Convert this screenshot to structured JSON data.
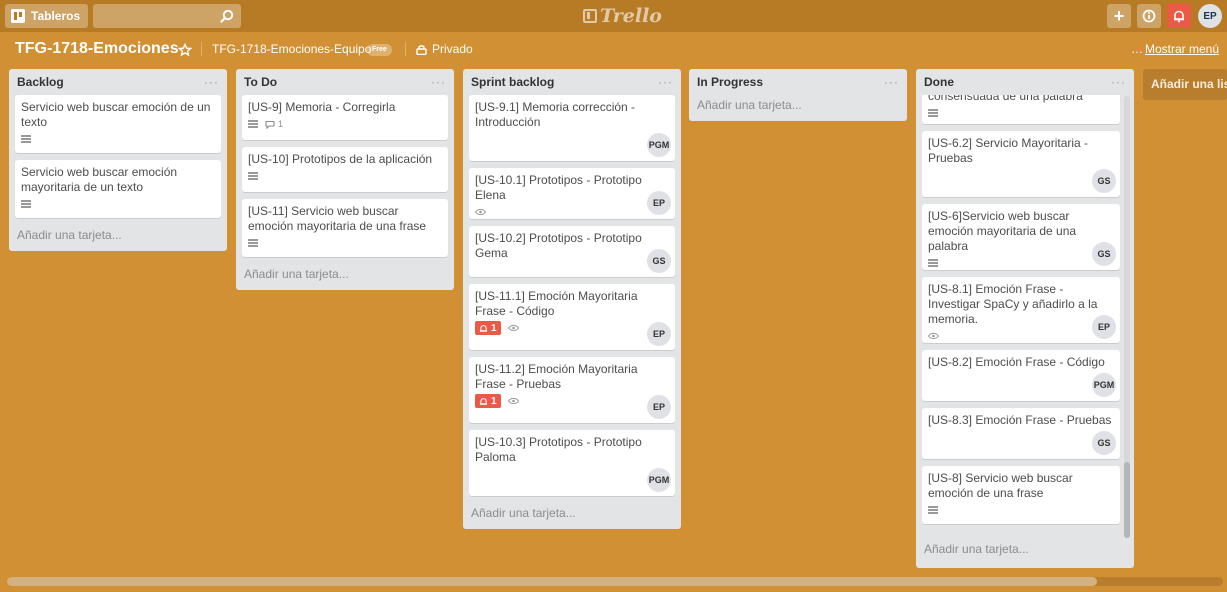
{
  "topbar": {
    "boards_label": "Tableros",
    "search_value": "",
    "logo_text": "Trello",
    "user_initials": "EP"
  },
  "board": {
    "title": "TFG-1718-Emociones",
    "team": "TFG-1718-Emociones-Equipo",
    "team_badge": "Free",
    "privacy": "Privado",
    "show_menu": "Mostrar menú",
    "add_list": "Añadir una lista"
  },
  "colors": {
    "board_bg": "#d29034",
    "topbar_bg": "#b87b25",
    "alarm_red": "#eb5a46",
    "list_bg": "#e2e4e6"
  },
  "lists": [
    {
      "title": "Backlog",
      "menu": "···",
      "add_card": "Añadir una tarjeta...",
      "cards": [
        {
          "text": "Servicio web buscar emoción de un texto"
        },
        {
          "text": "Servicio web buscar emoción mayoritaria de un texto"
        }
      ]
    },
    {
      "title": "To Do",
      "menu": "···",
      "add_card": "Añadir una tarjeta...",
      "cards": [
        {
          "text": "[US-9] Memoria - Corregirla",
          "comments": "1"
        },
        {
          "text": "[US-10] Prototipos de la aplicación"
        },
        {
          "text": "[US-11] Servicio web buscar emoción mayoritaria de una frase"
        }
      ]
    },
    {
      "title": "Sprint backlog",
      "menu": "···",
      "add_card": "Añadir una tarjeta...",
      "cards": [
        {
          "text": "[US-9.1] Memoria corrección - Introducción",
          "member": "PGM"
        },
        {
          "text": "[US-10.1] Prototipos - Prototipo Elena",
          "member": "EP"
        },
        {
          "text": "[US-10.2] Prototipos - Prototipo Gema",
          "member": "GS"
        },
        {
          "text": "[US-11.1] Emoción Mayoritaria Frase - Código",
          "alarm": "1",
          "member": "EP"
        },
        {
          "text": "[US-11.2] Emoción Mayoritaria Frase - Pruebas",
          "alarm": "1",
          "member": "EP"
        },
        {
          "text": "[US-10.3] Prototipos - Prototipo Paloma",
          "member": "PGM"
        }
      ]
    },
    {
      "title": "In Progress",
      "menu": "···",
      "add_card": "Añadir una tarjeta...",
      "cards": []
    },
    {
      "title": "Done",
      "menu": "···",
      "add_card": "Añadir una tarjeta...",
      "cards": [
        {
          "text": "consensuada de una palabra"
        },
        {
          "text": "[US-6.2] Servicio Mayoritaria - Pruebas",
          "member": "GS"
        },
        {
          "text": "[US-6]Servicio web buscar emoción mayoritaria de una palabra",
          "member": "GS"
        },
        {
          "text": "[US-8.1] Emoción Frase - Investigar SpaCy y añadirlo a la memoria.",
          "member": "EP"
        },
        {
          "text": "[US-8.2] Emoción Frase - Código",
          "member": "PGM"
        },
        {
          "text": "[US-8.3] Emoción Frase - Pruebas",
          "member": "GS"
        },
        {
          "text": "[US-8] Servicio web buscar emoción de una frase"
        }
      ]
    }
  ]
}
